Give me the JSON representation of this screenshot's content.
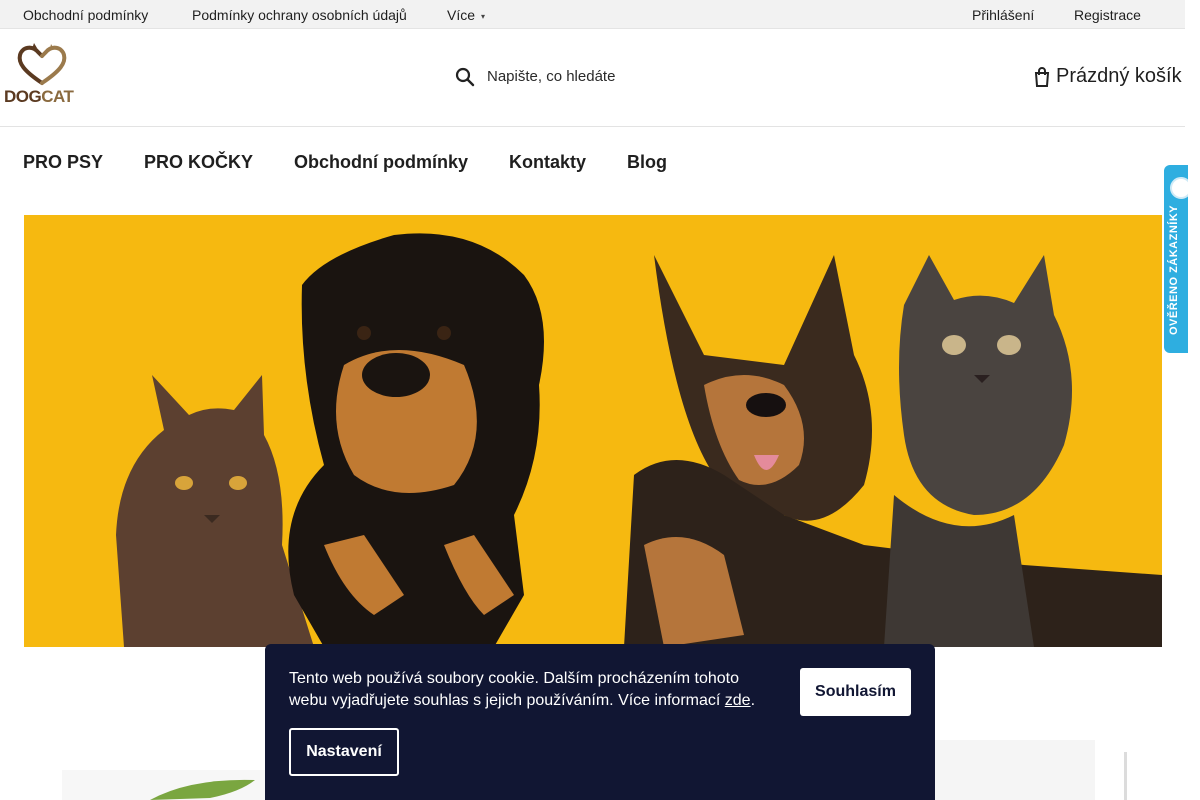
{
  "topbar": {
    "links": [
      "Obchodní podmínky",
      "Podmínky ochrany osobních údajů",
      "Více"
    ],
    "login": "Přihlášení",
    "register": "Registrace"
  },
  "header": {
    "logo": {
      "part1": "DOG",
      "part2": "CAT",
      "icon": "heart-dog-cat-logo"
    },
    "search": {
      "placeholder": "Napište, co hledáte",
      "icon": "search-icon"
    },
    "cart": {
      "label": "Prázdný košík",
      "icon": "cart-icon"
    }
  },
  "nav": {
    "items": [
      "PRO PSY",
      "PRO KOČKY",
      "Obchodní podmínky",
      "Kontakty",
      "Blog"
    ]
  },
  "badge": {
    "text": "OVĚŘENO ZÁKAZNÍKY"
  },
  "hero": {
    "image": "banner-cats-and-dogs",
    "background_color": "#f6b910"
  },
  "cookie": {
    "message": "Tento web používá soubory cookie. Dalším procházením tohoto webu vyjadřujete souhlas s jejich používáním. Více informací ",
    "link": "zde",
    "after_link": ".",
    "agree": "Souhlasím",
    "settings": "Nastavení",
    "background_color": "#111633"
  }
}
